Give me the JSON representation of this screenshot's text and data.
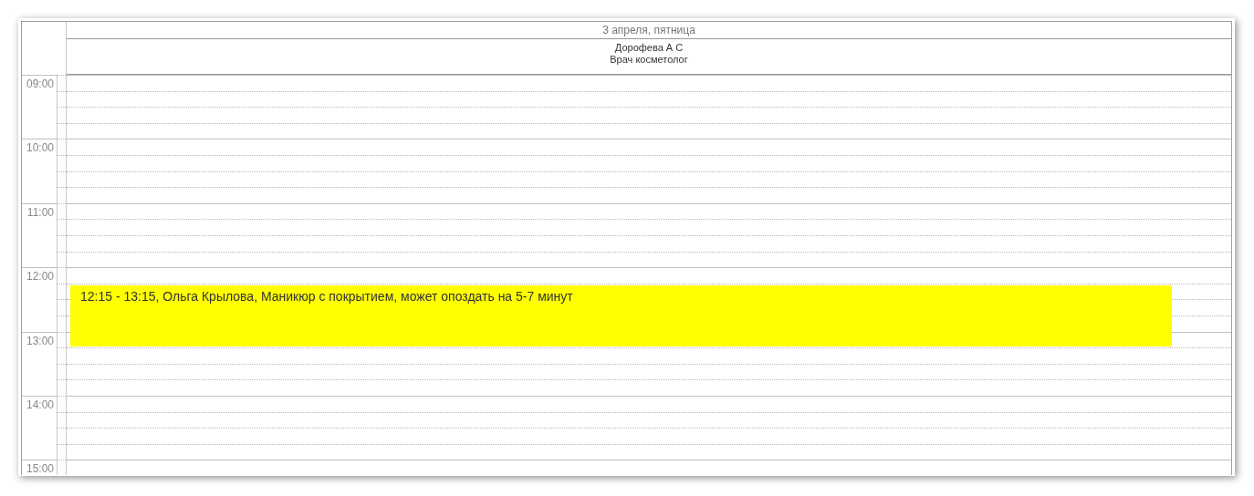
{
  "day_header": "3 апреля, пятница",
  "resource": {
    "name": "Дорофева А С",
    "role": "Врач косметолог"
  },
  "hours": [
    {
      "time": "09:00"
    },
    {
      "time": "10:00"
    },
    {
      "time": "11:00"
    },
    {
      "time": "12:00",
      "events": [
        {
          "text": "12:15 - 13:15, Ольга Крылова, Маникюр с покрытием, может опоздать на 5-7 минут",
          "color": "#ffff00"
        }
      ]
    },
    {
      "time": "13:00"
    },
    {
      "time": "14:00"
    },
    {
      "time": "15:00"
    }
  ]
}
